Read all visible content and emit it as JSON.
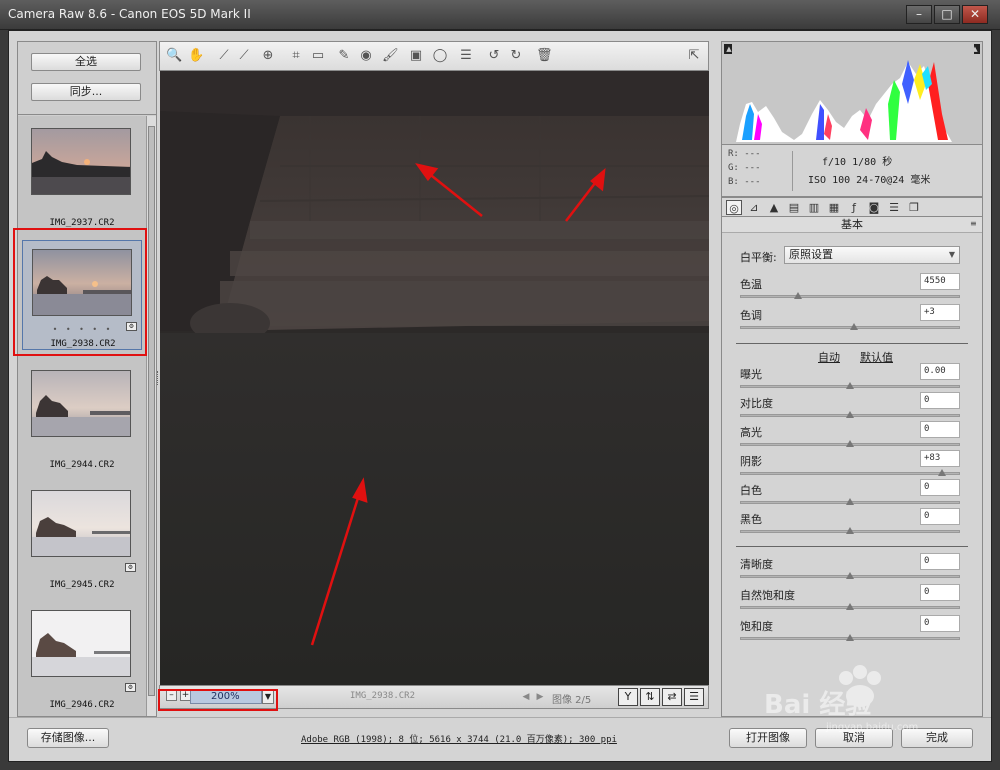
{
  "window": {
    "title": "Camera Raw 8.6  -  Canon EOS 5D Mark II",
    "minimize": "–",
    "maximize": "□",
    "close": "✕"
  },
  "filmstrip": {
    "select_all": "全选",
    "sync": "同步...",
    "items": [
      {
        "name": "IMG_2937.CR2",
        "selected": false
      },
      {
        "name": "IMG_2938.CR2",
        "selected": true,
        "rating": "• • • • •"
      },
      {
        "name": "IMG_2944.CR2",
        "selected": false
      },
      {
        "name": "IMG_2945.CR2",
        "selected": false
      },
      {
        "name": "IMG_2946.CR2",
        "selected": false
      }
    ]
  },
  "toolbar": {
    "tools": [
      "zoom-tool",
      "hand-tool",
      "white-balance-tool",
      "color-sampler-tool",
      "targeted-adjustment-tool",
      "crop-tool",
      "straighten-tool",
      "spot-removal-tool",
      "red-eye-tool",
      "adjustment-brush",
      "graduated-filter",
      "radial-filter",
      "preferences",
      "rotate-ccw",
      "rotate-cw",
      "trash"
    ]
  },
  "preview": {
    "filename": "IMG_2938.CR2",
    "zoom": "200%",
    "image_count": "图像 2/5"
  },
  "histogram": {
    "r": "R:  ---",
    "g": "G:  ---",
    "b": "B:  ---",
    "aperture_shutter": "f/10   1/80 秒",
    "iso_lens": "ISO 100   24-70@24 毫米"
  },
  "panel": {
    "title": "基本",
    "white_balance_label": "白平衡:",
    "white_balance_value": "原照设置",
    "auto": "自动",
    "default": "默认值",
    "controls": [
      {
        "label": "色温",
        "value": "4550",
        "pos": 0.26
      },
      {
        "label": "色调",
        "value": "+3",
        "pos": 0.52
      },
      {
        "label": "曝光",
        "value": "0.00",
        "pos": 0.5
      },
      {
        "label": "对比度",
        "value": "0",
        "pos": 0.5
      },
      {
        "label": "高光",
        "value": "0",
        "pos": 0.5
      },
      {
        "label": "阴影",
        "value": "+83",
        "pos": 0.92
      },
      {
        "label": "白色",
        "value": "0",
        "pos": 0.5
      },
      {
        "label": "黑色",
        "value": "0",
        "pos": 0.5
      },
      {
        "label": "清晰度",
        "value": "0",
        "pos": 0.5
      },
      {
        "label": "自然饱和度",
        "value": "0",
        "pos": 0.5
      },
      {
        "label": "饱和度",
        "value": "0",
        "pos": 0.5
      }
    ]
  },
  "bottom": {
    "save": "存储图像...",
    "workflow": "Adobe RGB (1998); 8 位; 5616 x 3744 (21.0 百万像素); 300 ppi",
    "open": "打开图像",
    "cancel": "取消",
    "done": "完成"
  },
  "watermark": {
    "text": "Bai 经验",
    "sub": "jingyan.baidu.com"
  },
  "colors": {
    "highlight": "#e01010",
    "selected_thumb": "#5577aa"
  }
}
